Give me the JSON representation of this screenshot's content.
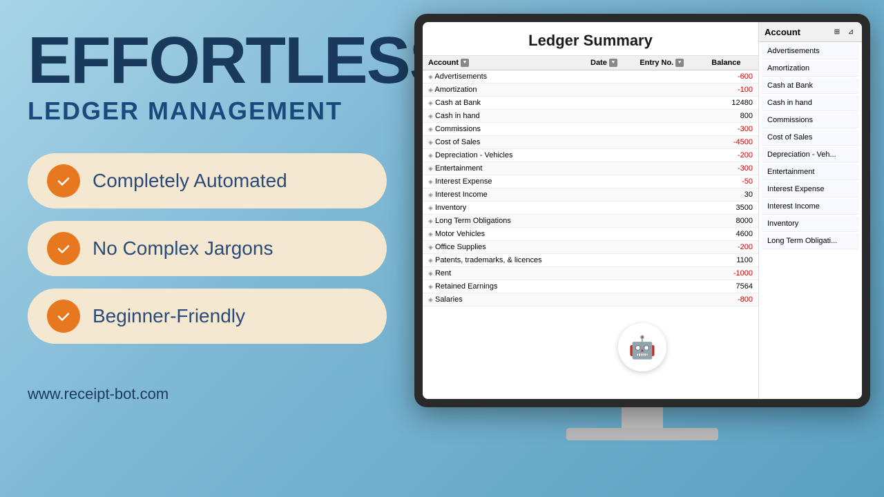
{
  "header": {
    "main_title": "EFFORTLESS",
    "sub_title": "LEDGER MANAGEMENT"
  },
  "features": [
    {
      "id": "automated",
      "label": "Completely Automated"
    },
    {
      "id": "jargons",
      "label": "No Complex Jargons"
    },
    {
      "id": "beginner",
      "label": "Beginner-Friendly"
    }
  ],
  "website": "www.receipt-bot.com",
  "ledger": {
    "title": "Ledger Summary",
    "columns": [
      "Account",
      "Date",
      "Entry No.",
      "Balance"
    ],
    "rows": [
      {
        "account": "Advertisements",
        "balance": "-600"
      },
      {
        "account": "Amortization",
        "balance": "-100"
      },
      {
        "account": "Cash at Bank",
        "balance": "12480"
      },
      {
        "account": "Cash in hand",
        "balance": "800"
      },
      {
        "account": "Commissions",
        "balance": "-300"
      },
      {
        "account": "Cost of Sales",
        "balance": "-4500"
      },
      {
        "account": "Depreciation - Vehicles",
        "balance": "-200"
      },
      {
        "account": "Entertainment",
        "balance": "-300"
      },
      {
        "account": "Interest Expense",
        "balance": "-50"
      },
      {
        "account": "Interest Income",
        "balance": "30"
      },
      {
        "account": "Inventory",
        "balance": "3500"
      },
      {
        "account": "Long Term Obligations",
        "balance": "8000"
      },
      {
        "account": "Motor Vehicles",
        "balance": "4600"
      },
      {
        "account": "Office Supplies",
        "balance": "-200"
      },
      {
        "account": "Patents, trademarks, & licences",
        "balance": "1100"
      },
      {
        "account": "Rent",
        "balance": "-1000"
      },
      {
        "account": "Retained Earnings",
        "balance": "7564"
      },
      {
        "account": "Salaries",
        "balance": "-800"
      }
    ]
  },
  "account_sidebar": {
    "header": "Account",
    "items": [
      "Advertisements",
      "Amortization",
      "Cash at Bank",
      "Cash in hand",
      "Commissions",
      "Cost of Sales",
      "Depreciation - Veh...",
      "Entertainment",
      "Interest Expense",
      "Interest Income",
      "Inventory",
      "Long Term Obligati..."
    ]
  },
  "colors": {
    "bg_gradient_start": "#a8d4e8",
    "bg_gradient_end": "#5a9fc0",
    "title_dark": "#1a3a5c",
    "orange": "#e87820",
    "feature_bg": "#f5e8d0"
  }
}
